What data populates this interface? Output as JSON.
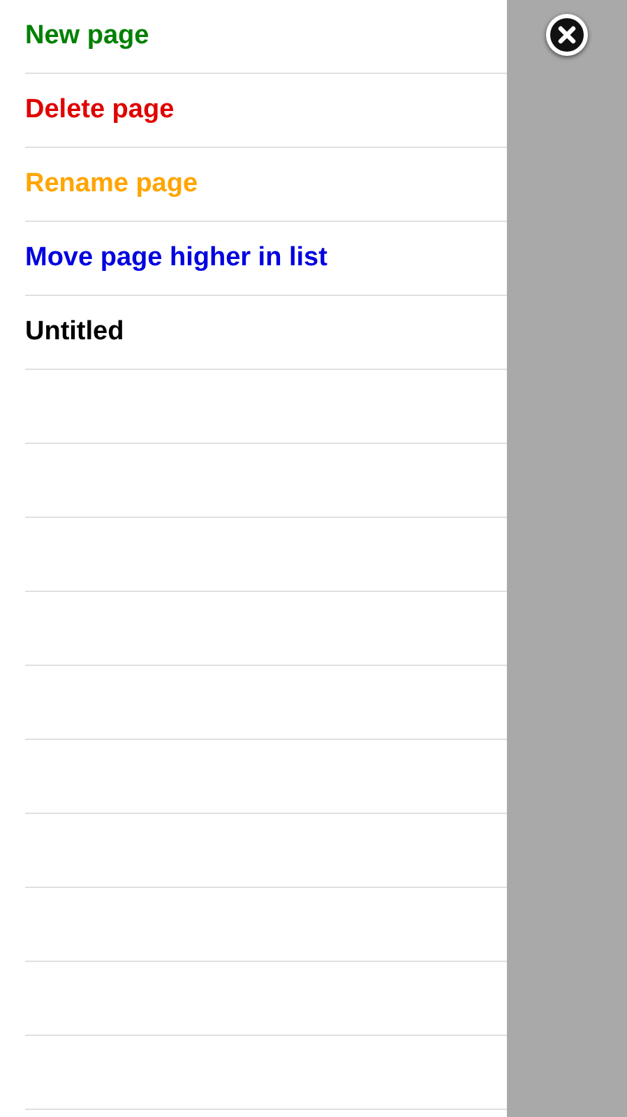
{
  "menu": [
    {
      "label": "New page",
      "color": "#008000"
    },
    {
      "label": "Delete page",
      "color": "#e00000"
    },
    {
      "label": "Rename page",
      "color": "#ffa500"
    },
    {
      "label": "Move page higher in list",
      "color": "#0000e0"
    },
    {
      "label": "Untitled",
      "color": "#000000"
    }
  ]
}
